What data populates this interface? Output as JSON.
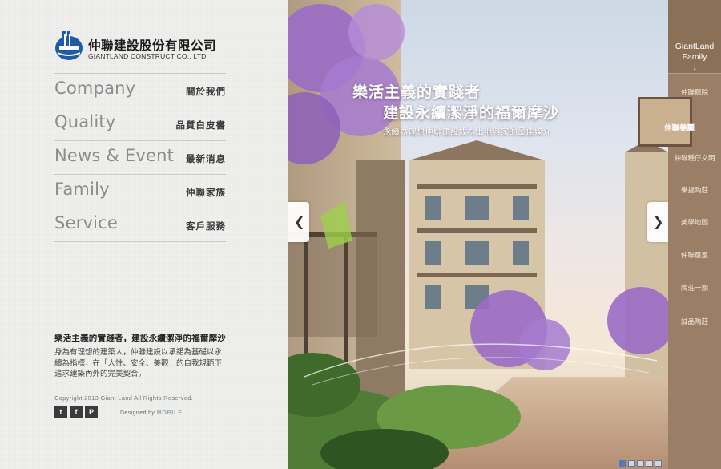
{
  "brand": {
    "name_zh": "仲聯建設股份有限公司",
    "name_en": "GIANTLAND CONSTRUCT CO., LTD."
  },
  "nav": [
    {
      "en": "Company",
      "zh": "關於我們"
    },
    {
      "en": "Quality",
      "zh": "品質白皮書"
    },
    {
      "en": "News & Event",
      "zh": "最新消息"
    },
    {
      "en": "Family",
      "zh": "仲聯家族"
    },
    {
      "en": "Service",
      "zh": "客戶服務"
    }
  ],
  "intro": {
    "title": "樂活主義的實踐者，建設永續潔淨的福爾摩沙",
    "body": "身為有理想的建築人，仲聯建設以承諾為基礎以永續為指標，在「人性、安全、美觀」的自我規範下追求建築內外的完美契合。"
  },
  "footer": {
    "copyright": "Copyright 2013  Giant Land All Rights Reserved.",
    "social": [
      "t",
      "f",
      "P"
    ],
    "designed_by": "Designed by",
    "designer": "MOBILE"
  },
  "hero": {
    "headline1": "樂活主義的實踐者",
    "headline2": "建設永續潔淨的福爾摩沙",
    "subline": "永續為理想仲聯建設成為土地與家的最佳媒介",
    "prev_icon": "chevron-left-icon",
    "next_icon": "chevron-right-icon",
    "pager_count": 5,
    "pager_active": 0
  },
  "family": {
    "title": "GiantLand Family",
    "arrow": "↓",
    "items": [
      "仲聯聽院",
      "仲聯美麗",
      "仲聯種仔文明",
      "樂揚陶莊",
      "美學地圖",
      "仲聯璽璽",
      "陶莊一期",
      "誠品陶莊"
    ],
    "featured_index": 1
  },
  "colors": {
    "sidebar": "#9a7f66",
    "sidebar_header": "#8b7058",
    "logo_blue": "#1f5ca8",
    "jacaranda": "#9b6bc6"
  }
}
